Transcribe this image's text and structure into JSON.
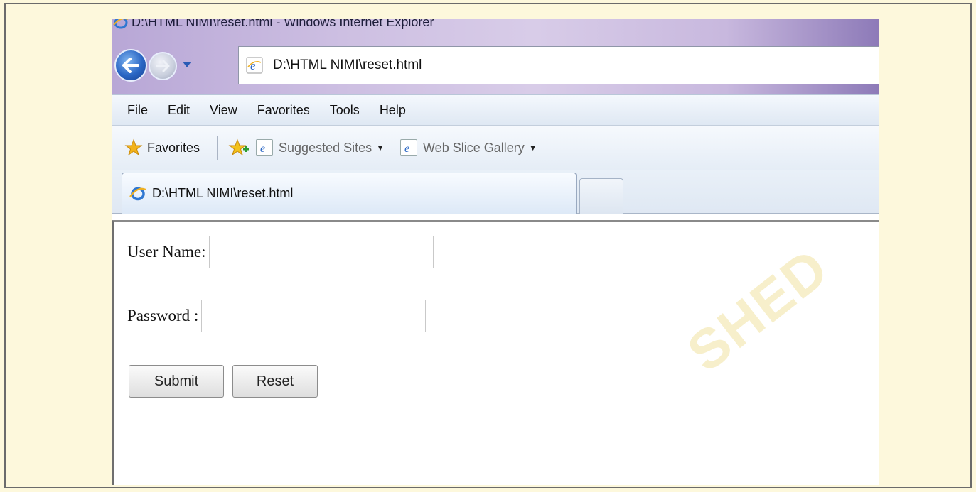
{
  "window": {
    "title": "D:\\HTML NIMI\\reset.html - Windows Internet Explorer"
  },
  "address_bar": {
    "url": "D:\\HTML NIMI\\reset.html"
  },
  "menu": {
    "items": [
      "File",
      "Edit",
      "View",
      "Favorites",
      "Tools",
      "Help"
    ]
  },
  "favorites_bar": {
    "favorites_label": "Favorites",
    "links": [
      {
        "label": "Suggested Sites"
      },
      {
        "label": "Web Slice Gallery"
      }
    ]
  },
  "tabs": {
    "active_label": "D:\\HTML NIMI\\reset.html"
  },
  "form": {
    "username_label": "User Name:",
    "username_value": "",
    "password_label": "Password :",
    "password_value": "",
    "submit_label": "Submit",
    "reset_label": "Reset"
  },
  "watermark": {
    "text": "SHED"
  },
  "colors": {
    "page_background": "#fdf8dc",
    "title_gradient_start": "#b8a7d6",
    "ie_blue": "#2a66c4",
    "favorites_star": "#f2b21b"
  }
}
